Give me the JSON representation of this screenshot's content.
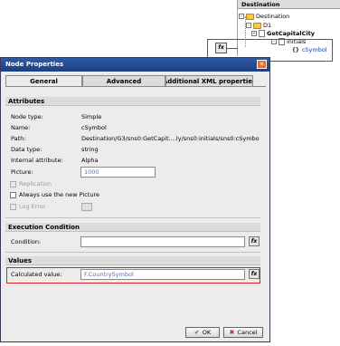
{
  "destination": {
    "header": "Destination",
    "nodes": [
      {
        "label": "Destination"
      },
      {
        "label": "D1"
      },
      {
        "label": "GetCapitalCity"
      },
      {
        "label": "initials"
      },
      {
        "label": "cSymbol"
      }
    ]
  },
  "icons": {
    "fx": "fx",
    "brace": "{}",
    "expand": "-",
    "close": "✕",
    "ok": "✔",
    "cancel": "✖"
  },
  "dialog": {
    "title": "Node Properties",
    "tabs": [
      {
        "label": "General",
        "active": true
      },
      {
        "label": "Advanced",
        "active": false
      },
      {
        "label": "Additional XML properties",
        "active": false
      }
    ],
    "attributes": {
      "header": "Attributes",
      "rows": [
        {
          "label": "Node type:",
          "value": "Simple"
        },
        {
          "label": "Name:",
          "value": "cSymbol"
        },
        {
          "label": "Path:",
          "value": "Destination/G3/sns0:GetCapit....ly/sns0:initials/sns0:cSymbo"
        },
        {
          "label": "Data type:",
          "value": "string"
        },
        {
          "label": "Internal attribute:",
          "value": "Alpha"
        }
      ],
      "picture_label": "Picture:",
      "picture_value": "1000",
      "replication_label": "Replication",
      "always_use_label": "Always use the new Picture",
      "log_error_label": "Log Error"
    },
    "execution": {
      "header": "Execution Condition",
      "condition_label": "Condition:",
      "condition_value": ""
    },
    "values": {
      "header": "Values",
      "calculated_label": "Calculated value:",
      "calculated_value": "F.CountrySymbol"
    },
    "ok_label": "OK",
    "cancel_label": "Cancel"
  },
  "colors": {
    "title_bar": "#1c3f80",
    "callout": "#e02020",
    "input_text": "#6070a0"
  }
}
